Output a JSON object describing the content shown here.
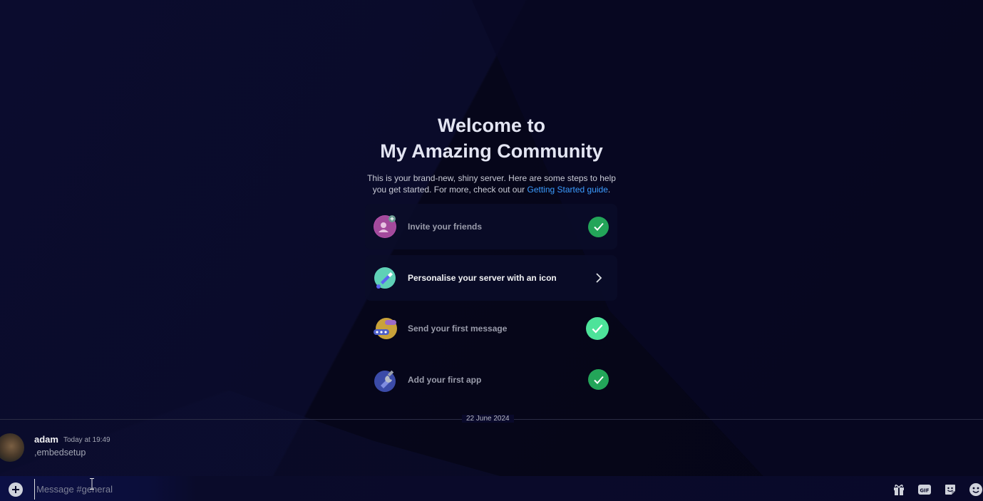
{
  "welcome": {
    "title_line1": "Welcome to",
    "title_line2": "My Amazing Community",
    "desc_line1": "This is your brand-new, shiny server. Here are some steps to help",
    "desc_line2_pre": "you get started. For more, check out our ",
    "desc_link": "Getting Started guide",
    "desc_line2_post": "."
  },
  "checklist": [
    {
      "label": "Invite your friends",
      "status": "done",
      "icon": "invite-friends-icon"
    },
    {
      "label": "Personalise your server with an icon",
      "status": "todo",
      "icon": "personalise-icon"
    },
    {
      "label": "Send your first message",
      "status": "done",
      "icon": "send-message-icon"
    },
    {
      "label": "Add your first app",
      "status": "done",
      "icon": "add-app-icon"
    }
  ],
  "divider": {
    "date": "22 June 2024"
  },
  "message": {
    "author": "adam",
    "timestamp": "Today at 19:49",
    "content": ",embedsetup"
  },
  "composer": {
    "placeholder": "Message #general"
  },
  "colors": {
    "accent_link": "#3b9cff",
    "success": "#23a559",
    "success_bright": "#4de39a",
    "background": "#07071f"
  }
}
